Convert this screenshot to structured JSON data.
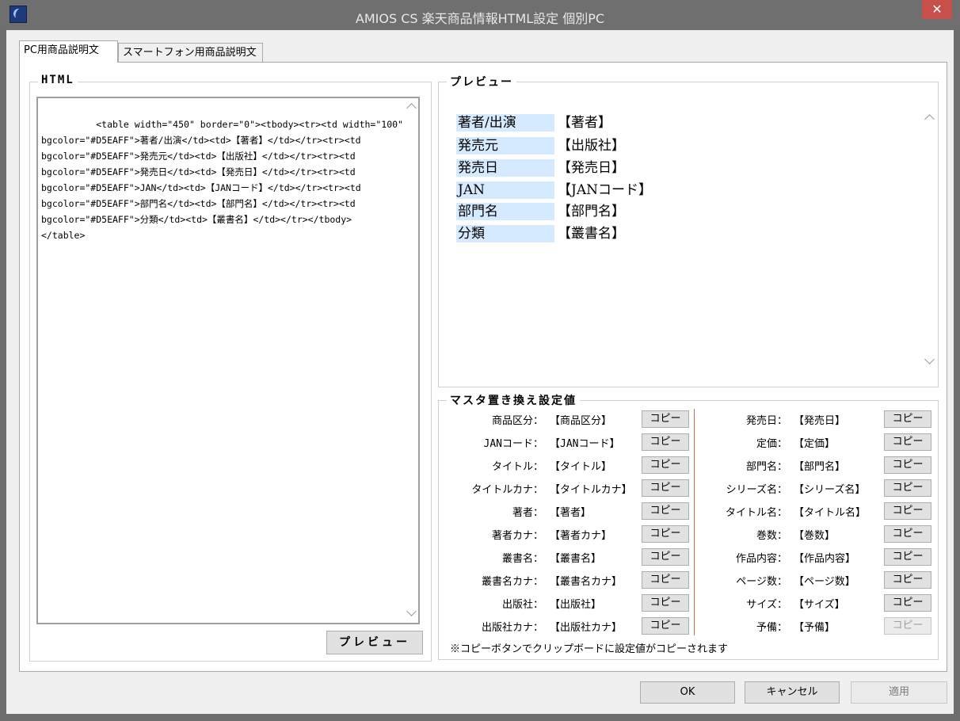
{
  "window": {
    "title": "AMIOS CS 楽天商品情報HTML設定 個別PC",
    "close_label": "✕"
  },
  "tabs": [
    {
      "label": "PC用商品説明文",
      "active": true
    },
    {
      "label": "スマートフォン用商品説明文",
      "active": false
    }
  ],
  "html_group": {
    "title": "HTML",
    "content": "<table width=\"450\" border=\"0\"><tbody><tr><td width=\"100\"\nbgcolor=\"#D5EAFF\">著者/出演</td><td>【著者】</td></tr><tr><td\nbgcolor=\"#D5EAFF\">発売元</td><td>【出版社】</td></tr><tr><td\nbgcolor=\"#D5EAFF\">発売日</td><td>【発売日】</td></tr><tr><td\nbgcolor=\"#D5EAFF\">JAN</td><td>【JANコード】</td></tr><tr><td\nbgcolor=\"#D5EAFF\">部門名</td><td>【部門名】</td></tr><tr><td\nbgcolor=\"#D5EAFF\">分類</td><td>【叢書名】</td></tr></tbody>\n</table>",
    "preview_button": "プレビュー"
  },
  "preview_group": {
    "title": "プレビュー",
    "rows": [
      {
        "label": "著者/出演",
        "value": "【著者】"
      },
      {
        "label": "発売元",
        "value": "【出版社】"
      },
      {
        "label": "発売日",
        "value": "【発売日】"
      },
      {
        "label": "JAN",
        "value": "【JANコード】"
      },
      {
        "label": "部門名",
        "value": "【部門名】"
      },
      {
        "label": "分類",
        "value": "【叢書名】"
      }
    ],
    "label_bg": "#D5EAFF"
  },
  "master_group": {
    "title": "マスタ置き換え設定値",
    "copy_label": "コピー",
    "left": [
      {
        "label": "商品区分：",
        "value": "【商品区分】"
      },
      {
        "label": "JANコード：",
        "value": "【JANコード】"
      },
      {
        "label": "タイトル：",
        "value": "【タイトル】"
      },
      {
        "label": "タイトルカナ：",
        "value": "【タイトルカナ】"
      },
      {
        "label": "著者：",
        "value": "【著者】"
      },
      {
        "label": "著者カナ：",
        "value": "【著者カナ】"
      },
      {
        "label": "叢書名：",
        "value": "【叢書名】"
      },
      {
        "label": "叢書名カナ：",
        "value": "【叢書名カナ】"
      },
      {
        "label": "出版社：",
        "value": "【出版社】"
      },
      {
        "label": "出版社カナ：",
        "value": "【出版社カナ】"
      }
    ],
    "right": [
      {
        "label": "発売日：",
        "value": "【発売日】"
      },
      {
        "label": "定価：",
        "value": "【定価】"
      },
      {
        "label": "部門名：",
        "value": "【部門名】"
      },
      {
        "label": "シリーズ名：",
        "value": "【シリーズ名】"
      },
      {
        "label": "タイトル名：",
        "value": "【タイトル名】"
      },
      {
        "label": "巻数：",
        "value": "【巻数】"
      },
      {
        "label": "作品内容：",
        "value": "【作品内容】"
      },
      {
        "label": "ページ数：",
        "value": "【ページ数】"
      },
      {
        "label": "サイズ：",
        "value": "【サイズ】"
      },
      {
        "label": "予備：",
        "value": "【予備】",
        "disabled": true
      }
    ],
    "note": "※コピーボタンでクリップボードに設定値がコピーされます"
  },
  "footer": {
    "ok": "OK",
    "cancel": "キャンセル",
    "apply": "適用"
  }
}
